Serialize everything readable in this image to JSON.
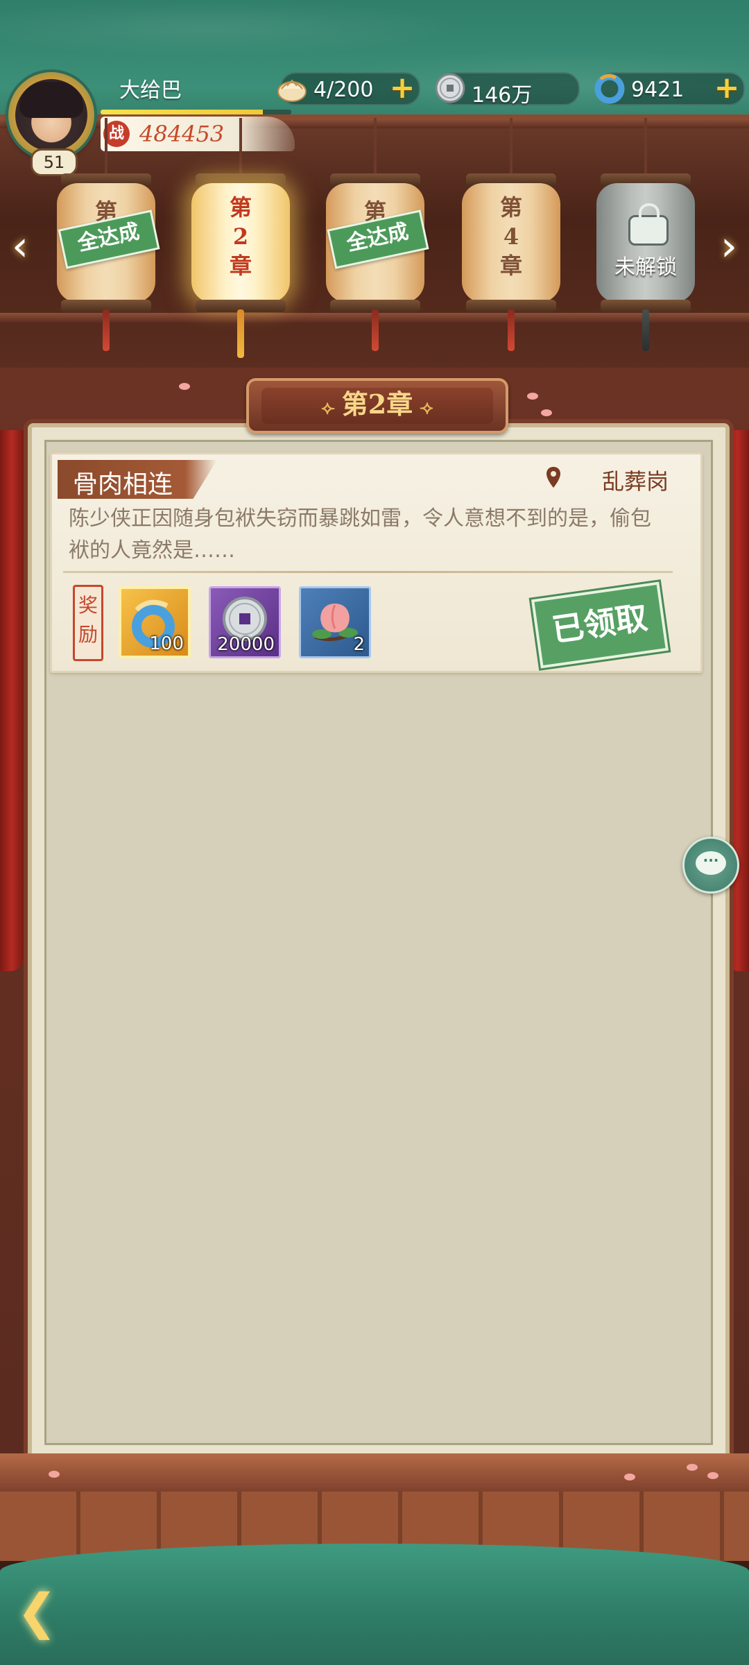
{
  "player": {
    "name": "大给巴",
    "level": "51",
    "power": "484453",
    "power_icon_label": "战",
    "exp_progress": 0.85
  },
  "currencies": [
    {
      "id": "stamina",
      "icon": "bun-icon",
      "value": "4/200",
      "has_plus": true
    },
    {
      "id": "silver",
      "icon": "coin-icon",
      "value": "146万",
      "has_plus": false
    },
    {
      "id": "jade",
      "icon": "jade-ring-icon",
      "value": "9421",
      "has_plus": true
    }
  ],
  "plus_label": "+",
  "chapters": [
    {
      "text": "第\n章",
      "status": "全达成",
      "state": "completed"
    },
    {
      "text": "第\n2\n章",
      "status": "",
      "state": "active"
    },
    {
      "text": "第\n章",
      "status": "全达成",
      "state": "completed"
    },
    {
      "text": "第\n4\n章",
      "status": "",
      "state": "normal"
    },
    {
      "text": "",
      "status": "未解锁",
      "state": "locked"
    }
  ],
  "nav": {
    "prev": "‹",
    "next": "›"
  },
  "chapter_title": "第2章",
  "quest": {
    "title": "骨肉相连",
    "location": "乱葬岗",
    "description": "陈少侠正因随身包袱失窃而暴跳如雷，令人意想不到的是，偷包袱的人竟然是……",
    "reward_label": "奖励",
    "rewards": [
      {
        "icon": "jade-ring-icon",
        "count": "100",
        "rarity": "gold"
      },
      {
        "icon": "silver-coin-icon",
        "count": "20000",
        "rarity": "purple"
      },
      {
        "icon": "peach-icon",
        "count": "2",
        "rarity": "blue"
      }
    ],
    "claimed_label": "已领取"
  },
  "chat_label": "···",
  "back_label": "❮",
  "colors": {
    "teal": "#3c8f78",
    "wood": "#6b3324",
    "parchment": "#e9e2cd",
    "stamp_green": "#57a063",
    "accent_gold": "#f6cf3a"
  }
}
